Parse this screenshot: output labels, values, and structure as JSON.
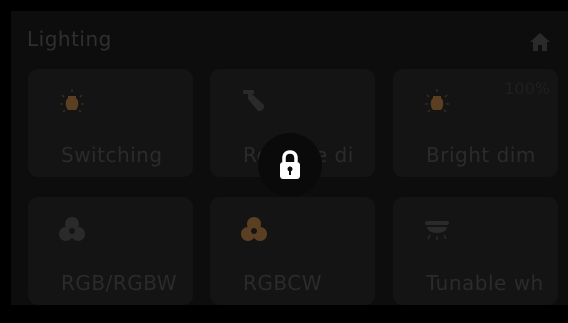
{
  "header": {
    "title": "Lighting",
    "home_icon": "home-icon"
  },
  "tiles": [
    {
      "label": "Switching",
      "icon": "light-bulb-icon",
      "status": ""
    },
    {
      "label": "Relative di",
      "icon": "spotlight-icon",
      "status": ""
    },
    {
      "label": "Bright dim",
      "icon": "light-bulb-icon",
      "status": "100%"
    },
    {
      "label": "RGB/RGBW",
      "icon": "rgb-color-icon",
      "status": ""
    },
    {
      "label": "RGBCW",
      "icon": "rgb-color-icon",
      "status": ""
    },
    {
      "label": "Tunable wh",
      "icon": "ceiling-light-icon",
      "status": ""
    }
  ],
  "overlay": {
    "icon": "lock-icon",
    "state": "locked"
  },
  "colors": {
    "background": "#000000",
    "tile": "#141414",
    "text_dim": "#2b2b2b",
    "accent_amber": "#5a3f22",
    "icon_grey": "#2a2a2a",
    "lock_white": "#ffffff"
  }
}
